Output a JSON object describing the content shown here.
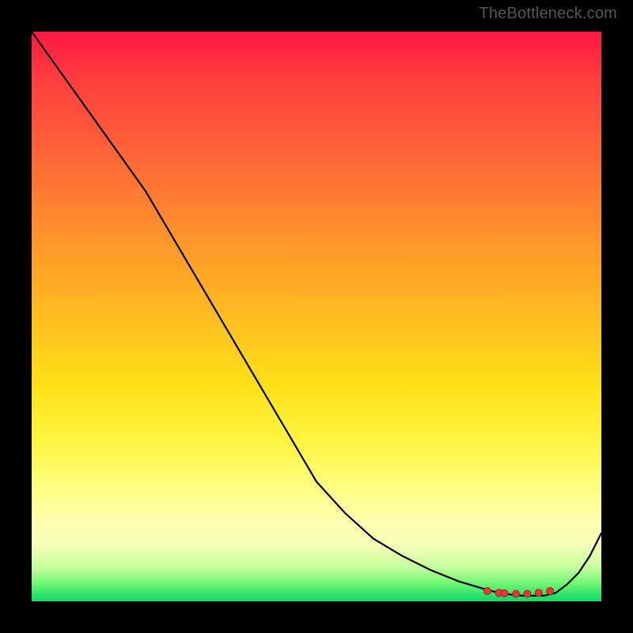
{
  "watermark": "TheBottleneck.com",
  "chart_data": {
    "type": "line",
    "title": "",
    "xlabel": "",
    "ylabel": "",
    "xlim": [
      0,
      100
    ],
    "ylim": [
      0,
      100
    ],
    "x": [
      0,
      5,
      10,
      15,
      20,
      25,
      30,
      35,
      40,
      45,
      50,
      55,
      60,
      65,
      70,
      75,
      80,
      82,
      84,
      86,
      88,
      90,
      92,
      94,
      96,
      98,
      100
    ],
    "y": [
      100,
      93,
      86,
      79,
      72,
      63.5,
      55,
      46.5,
      38,
      29.5,
      21,
      15.5,
      11,
      8,
      5.5,
      3.5,
      2,
      1.5,
      1.2,
      1,
      1,
      1,
      1.5,
      3,
      5,
      8,
      12
    ],
    "markers": {
      "x": [
        80,
        82,
        83,
        85,
        87,
        89,
        91
      ],
      "y": [
        1.8,
        1.5,
        1.4,
        1.3,
        1.3,
        1.5,
        1.8
      ]
    },
    "colors": {
      "line": "#000000",
      "marker_fill": "#e53935",
      "marker_stroke": "#b71c1c"
    }
  }
}
